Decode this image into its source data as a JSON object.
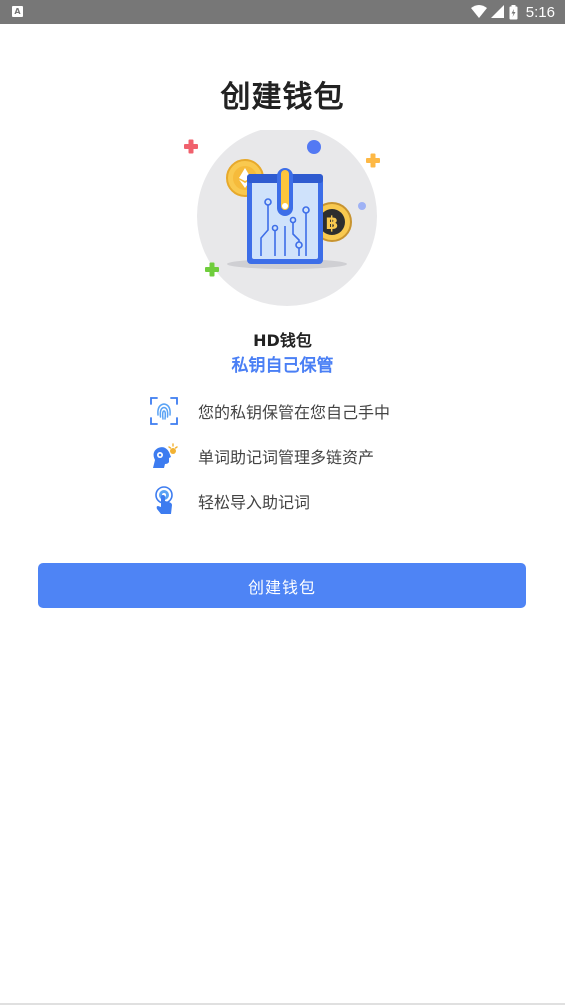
{
  "status_bar": {
    "time": "5:16",
    "app_icon_letter": "A"
  },
  "page": {
    "title": "创建钱包",
    "wallet_type": "HD钱包",
    "subtitle": "私钥自己保管"
  },
  "features": [
    {
      "icon": "fingerprint-icon",
      "label": "您的私钥保管在您自己手中"
    },
    {
      "icon": "brain-idea-icon",
      "label": "单词助记词管理多链资产"
    },
    {
      "icon": "touch-import-icon",
      "label": "轻松导入助记词"
    }
  ],
  "button": {
    "label": "创建钱包"
  },
  "colors": {
    "accent": "#4e84f5",
    "subtitle": "#4a7ff5",
    "title": "#222222",
    "feature_text": "#444444",
    "statusbar": "#777777"
  }
}
